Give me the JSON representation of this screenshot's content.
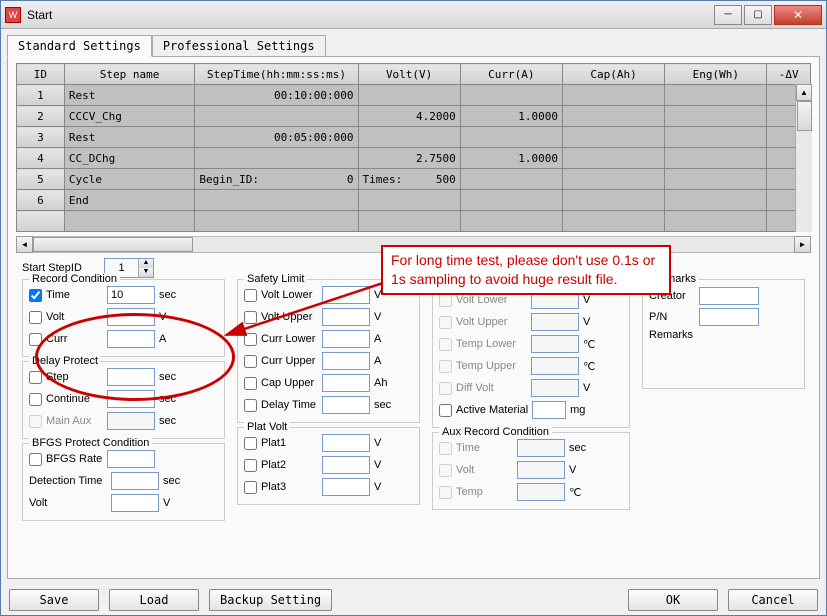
{
  "window": {
    "title": "Start"
  },
  "tabs": {
    "standard": "Standard Settings",
    "professional": "Professional Settings"
  },
  "table": {
    "headers": {
      "id": "ID",
      "step": "Step name",
      "time": "StepTime(hh:mm:ss:ms)",
      "volt": "Volt(V)",
      "curr": "Curr(A)",
      "cap": "Cap(Ah)",
      "eng": "Eng(Wh)",
      "dv": "-ΔV"
    },
    "rows": [
      {
        "id": "1",
        "step": "Rest",
        "time": "00:10:00:000",
        "volt": "",
        "curr": "",
        "cap": "",
        "eng": ""
      },
      {
        "id": "2",
        "step": "CCCV_Chg",
        "time": "",
        "volt": "4.2000",
        "curr": "1.0000",
        "cap": "",
        "eng": ""
      },
      {
        "id": "3",
        "step": "Rest",
        "time": "00:05:00:000",
        "volt": "",
        "curr": "",
        "cap": "",
        "eng": ""
      },
      {
        "id": "4",
        "step": "CC_DChg",
        "time": "",
        "volt": "2.7500",
        "curr": "1.0000",
        "cap": "",
        "eng": ""
      },
      {
        "id": "5",
        "step": "Cycle",
        "time_label": "Begin_ID:",
        "time_val": "0",
        "volt_label": "Times:",
        "volt_val": "500",
        "curr": "",
        "cap": "",
        "eng": ""
      },
      {
        "id": "6",
        "step": "End",
        "time": "",
        "volt": "",
        "curr": "",
        "cap": "",
        "eng": ""
      },
      {
        "id": "",
        "step": "",
        "time": "",
        "volt": "",
        "curr": "",
        "cap": "",
        "eng": ""
      }
    ]
  },
  "startStepId": {
    "label": "Start StepID",
    "value": "1"
  },
  "recordCondition": {
    "title": "Record Condition",
    "time": {
      "label": "Time",
      "value": "10",
      "unit": "sec",
      "checked": true
    },
    "volt": {
      "label": "Volt",
      "value": "",
      "unit": "V",
      "checked": false
    },
    "curr": {
      "label": "Curr",
      "value": "",
      "unit": "A",
      "checked": false
    }
  },
  "delayProtect": {
    "title": "Delay Protect",
    "step": {
      "label": "Step",
      "value": "",
      "unit": "sec"
    },
    "continue": {
      "label": "Continue",
      "value": "",
      "unit": "sec"
    },
    "mainAux": {
      "label": "Main Aux",
      "value": "",
      "unit": "sec"
    }
  },
  "bfgs": {
    "title": "BFGS Protect Condition",
    "rate": {
      "label": "BFGS Rate",
      "value": ""
    },
    "detection": {
      "label": "Detection Time",
      "value": "",
      "unit": "sec"
    },
    "volt": {
      "label": "Volt",
      "value": "",
      "unit": "V"
    }
  },
  "safetyLimit": {
    "title": "Safety Limit",
    "voltLower": {
      "label": "Volt Lower",
      "value": "",
      "unit": "V"
    },
    "voltUpper": {
      "label": "Volt Upper",
      "value": "",
      "unit": "V"
    },
    "currLower": {
      "label": "Curr Lower",
      "value": "",
      "unit": "A"
    },
    "currUpper": {
      "label": "Curr Upper",
      "value": "",
      "unit": "A"
    },
    "capUpper": {
      "label": "Cap Upper",
      "value": "",
      "unit": "Ah"
    },
    "delayTime": {
      "label": "Delay Time",
      "value": "",
      "unit": "sec"
    }
  },
  "safetyLimit2": {
    "voltLower": {
      "label": "Volt Lower",
      "value": "",
      "unit": "V"
    },
    "voltUpper": {
      "label": "Volt Upper",
      "value": "",
      "unit": "V"
    },
    "tempLower": {
      "label": "Temp Lower",
      "value": "",
      "unit": "℃"
    },
    "tempUpper": {
      "label": "Temp Upper",
      "value": "",
      "unit": "℃"
    },
    "diffVolt": {
      "label": "Diff Volt",
      "value": "",
      "unit": "V"
    },
    "activeMat": {
      "label": "Active Material",
      "value": "",
      "unit": "mg"
    }
  },
  "platVolt": {
    "title": "Plat Volt",
    "p1": {
      "label": "Plat1",
      "value": "",
      "unit": "V"
    },
    "p2": {
      "label": "Plat2",
      "value": "",
      "unit": "V"
    },
    "p3": {
      "label": "Plat3",
      "value": "",
      "unit": "V"
    }
  },
  "auxRecord": {
    "title": "Aux Record Condition",
    "time": {
      "label": "Time",
      "value": "",
      "unit": "sec"
    },
    "volt": {
      "label": "Volt",
      "value": "",
      "unit": "V"
    },
    "temp": {
      "label": "Temp",
      "value": "",
      "unit": "℃"
    }
  },
  "remarks": {
    "title": "Remarks",
    "creator": "Creator",
    "pn": "P/N",
    "remarks": "Remarks"
  },
  "callout": "For long time test, please don't use 0.1s or 1s sampling to avoid huge result file.",
  "buttons": {
    "save": "Save",
    "load": "Load",
    "backup": "Backup Setting",
    "ok": "OK",
    "cancel": "Cancel"
  }
}
